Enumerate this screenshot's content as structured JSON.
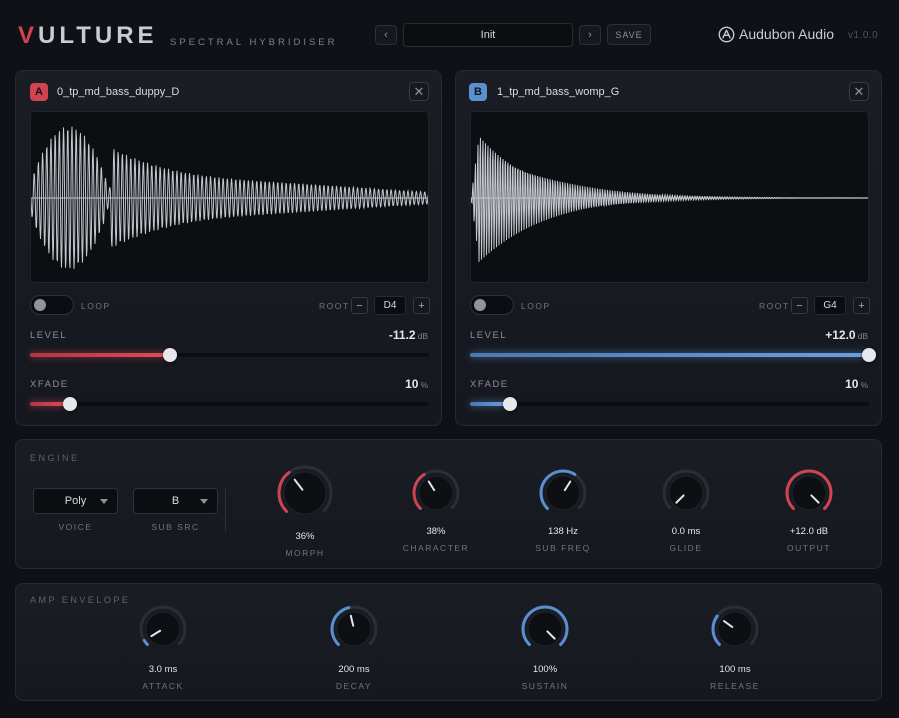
{
  "header": {
    "brand_first": "V",
    "brand_rest": "ULTURE",
    "subtitle": "SPECTRAL HYBRIDISER",
    "prev_glyph": "‹",
    "next_glyph": "›",
    "preset_name": "Init",
    "save_label": "SAVE",
    "company": "Audubon Audio",
    "company_icon": "audubon-logo-icon",
    "version": "v1.0.0"
  },
  "colors": {
    "accent_a": "#d04452",
    "accent_b": "#5a8fd0",
    "background": "#0f1116",
    "panel": "#1a1d24"
  },
  "slots": [
    {
      "badge": "A",
      "name": "0_tp_md_bass_duppy_D",
      "close_glyph": "✕",
      "loop_label": "LOOP",
      "loop_on": false,
      "root_label": "ROOT",
      "root_note": "D4",
      "minus_glyph": "−",
      "plus_glyph": "+",
      "level_label": "LEVEL",
      "level_value": "-11.2",
      "level_unit": "dB",
      "level_fraction": 0.35,
      "xfade_label": "XFADE",
      "xfade_value": "10",
      "xfade_unit": "%",
      "xfade_fraction": 0.1
    },
    {
      "badge": "B",
      "name": "1_tp_md_bass_womp_G",
      "close_glyph": "✕",
      "loop_label": "LOOP",
      "loop_on": false,
      "root_label": "ROOT",
      "root_note": "G4",
      "minus_glyph": "−",
      "plus_glyph": "+",
      "level_label": "LEVEL",
      "level_value": "+12.0",
      "level_unit": "dB",
      "level_fraction": 1.0,
      "xfade_label": "XFADE",
      "xfade_value": "10",
      "xfade_unit": "%",
      "xfade_fraction": 0.1
    }
  ],
  "engine": {
    "title": "ENGINE",
    "voice_value": "Poly",
    "voice_label": "VOICE",
    "subsrc_value": "B",
    "subsrc_label": "SUB SRC",
    "knobs": [
      {
        "id": "morph",
        "value": "36%",
        "label": "MORPH",
        "fraction": 0.36,
        "color": "#d04452"
      },
      {
        "id": "character",
        "value": "38%",
        "label": "CHARACTER",
        "fraction": 0.38,
        "color": "#d04452"
      },
      {
        "id": "sub-freq",
        "value": "138 Hz",
        "label": "SUB FREQ",
        "fraction": 0.62,
        "color": "#5a8fd0"
      },
      {
        "id": "glide",
        "value": "0.0 ms",
        "label": "GLIDE",
        "fraction": 0.0,
        "color": "#5a8fd0"
      },
      {
        "id": "output",
        "value": "+12.0 dB",
        "label": "OUTPUT",
        "fraction": 1.0,
        "color": "#d04452"
      }
    ]
  },
  "amp": {
    "title": "AMP ENVELOPE",
    "knobs": [
      {
        "id": "attack",
        "value": "3.0 ms",
        "label": "ATTACK",
        "fraction": 0.05,
        "color": "#5a8fd0"
      },
      {
        "id": "decay",
        "value": "200 ms",
        "label": "DECAY",
        "fraction": 0.45,
        "color": "#5a8fd0"
      },
      {
        "id": "sustain",
        "value": "100%",
        "label": "SUSTAIN",
        "fraction": 1.0,
        "color": "#5a8fd0"
      },
      {
        "id": "release",
        "value": "100 ms",
        "label": "RELEASE",
        "fraction": 0.3,
        "color": "#5a8fd0"
      }
    ]
  }
}
